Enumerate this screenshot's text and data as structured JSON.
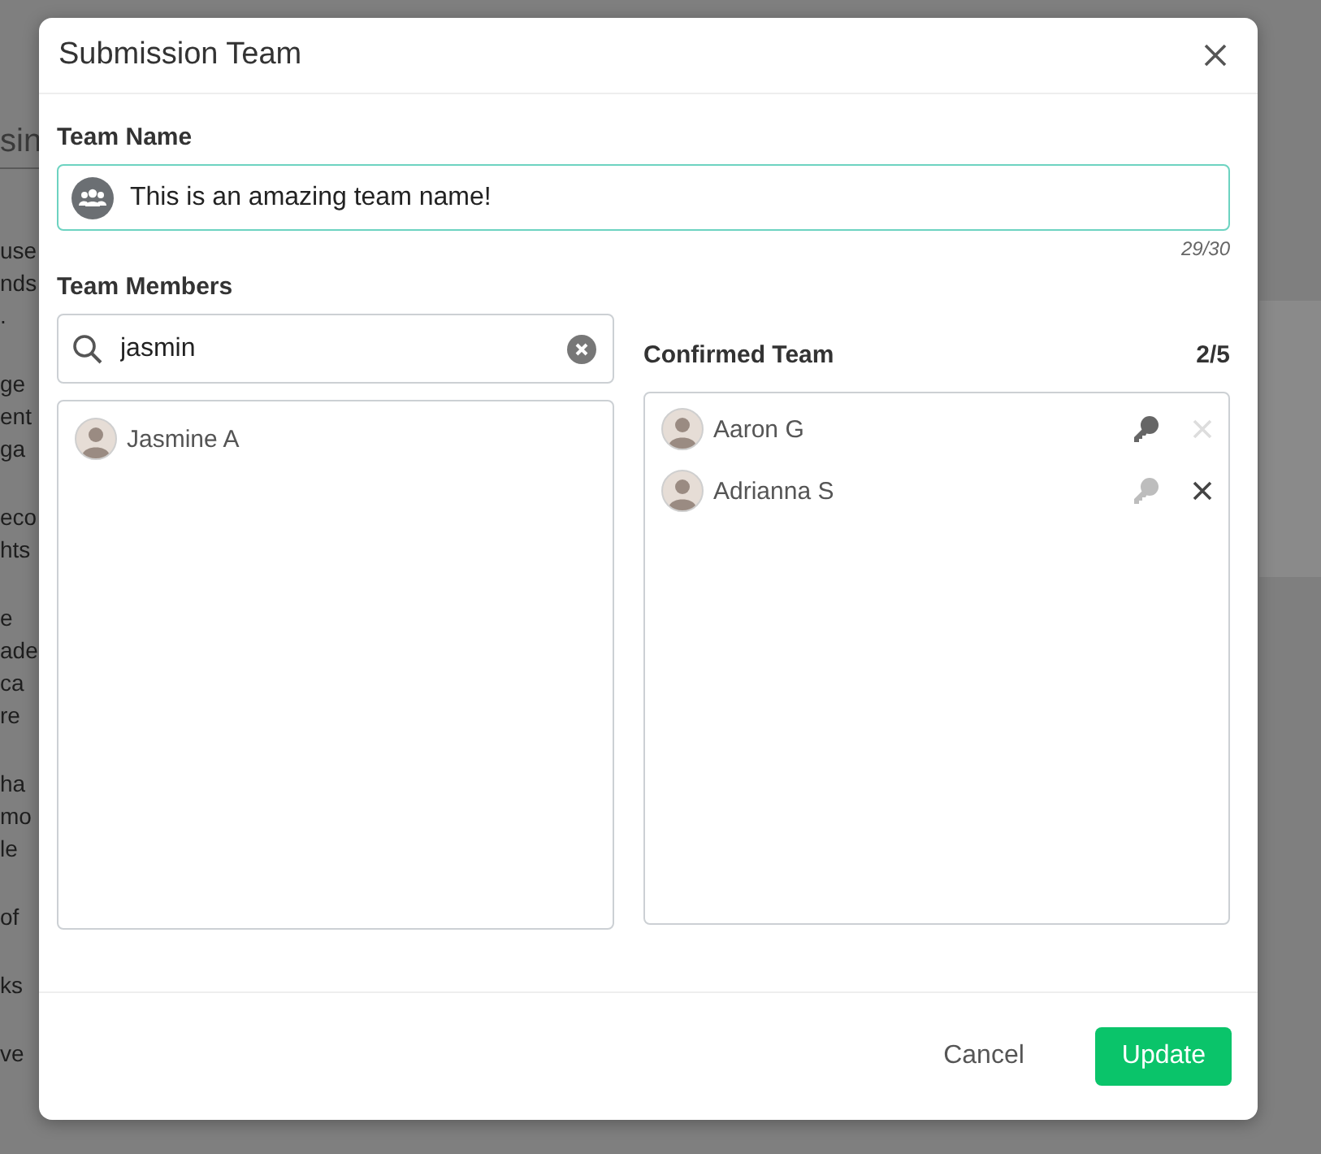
{
  "background": {
    "heading_fragment": "sin",
    "paragraphs": [
      [
        "use",
        "nds",
        "."
      ],
      [
        "ge",
        "ent",
        "ga"
      ],
      [
        "eco",
        "hts"
      ],
      [
        "e",
        "ade",
        "ca",
        "re"
      ],
      [
        "ha",
        "mo",
        "le"
      ],
      [
        "of"
      ],
      [
        "ks"
      ],
      [
        "ve"
      ]
    ]
  },
  "dialog": {
    "title": "Submission Team",
    "team_name": {
      "label": "Team Name",
      "value": "This is an amazing team name!",
      "counter": "29/30"
    },
    "members": {
      "label": "Team Members",
      "search": {
        "value": "jasmin"
      },
      "results": [
        {
          "name": "Jasmine A"
        }
      ],
      "confirmed": {
        "title": "Confirmed Team",
        "count": "2/5",
        "items": [
          {
            "name": "Aaron G",
            "owner": true,
            "removable": false
          },
          {
            "name": "Adrianna S",
            "owner": false,
            "removable": true
          }
        ]
      }
    },
    "buttons": [
      {
        "label": "Cancel",
        "kind": "secondary"
      },
      {
        "label": "Update",
        "kind": "primary"
      }
    ]
  }
}
